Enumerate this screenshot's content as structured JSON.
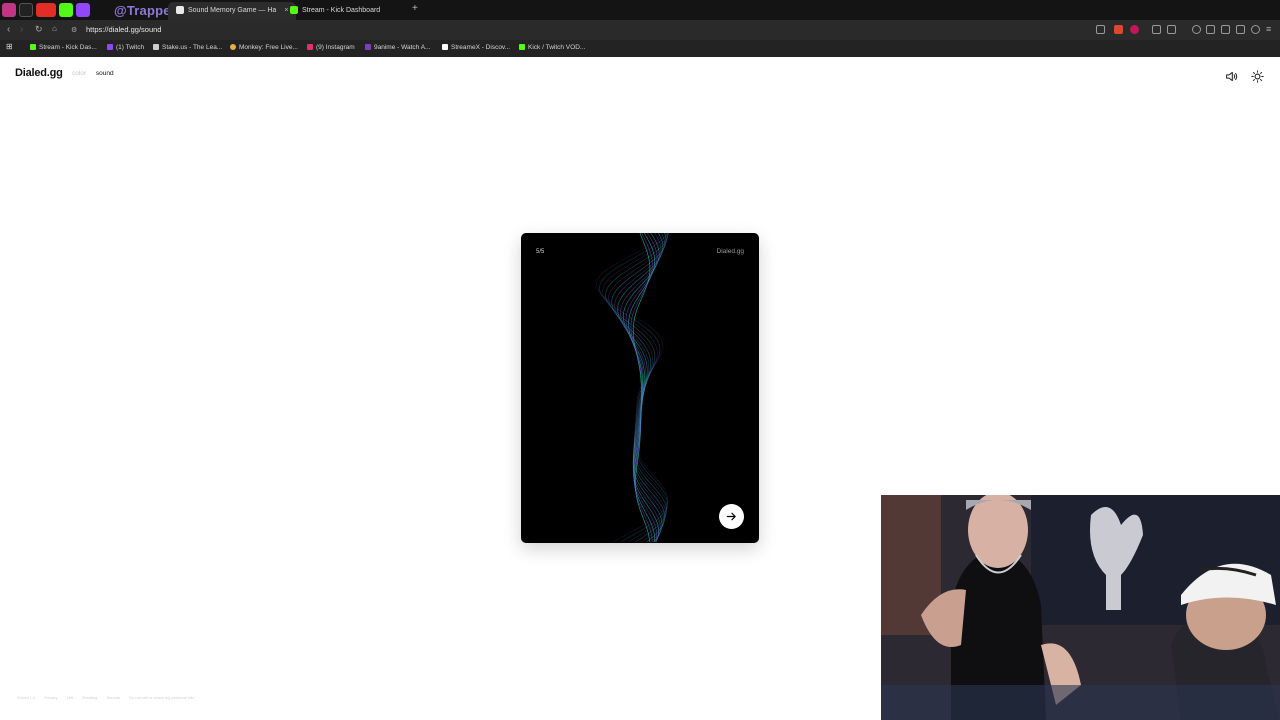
{
  "browser": {
    "overlay": {
      "streamer_name": "@TrappedDots"
    },
    "tabs": [
      {
        "label": "Sound Memory Game — Ha",
        "active": true
      },
      {
        "label": "Stream - Kick Dashboard",
        "active": false
      }
    ],
    "new_tab": "+",
    "tab_close": "×",
    "url": "https://dialed.gg/sound",
    "bookmarks": [
      {
        "label": "Stream - Kick Das...",
        "color": "#53fc18"
      },
      {
        "label": "(1) Twitch",
        "color": "#9146ff"
      },
      {
        "label": "Stake.us - The Lea...",
        "color": "#cccccc"
      },
      {
        "label": "Monkey: Free Live...",
        "color": "#e8b040"
      },
      {
        "label": "(9) Instagram",
        "color": "#e1306c"
      },
      {
        "label": "9anime - Watch A...",
        "color": "#7b3fbf"
      },
      {
        "label": "StreameX - Discov...",
        "color": "#ffffff"
      },
      {
        "label": "Kick / Twitch VOD...",
        "color": "#53fc18"
      }
    ]
  },
  "site": {
    "brand": "Dialed.gg",
    "nav": {
      "color": "color",
      "sound": "sound"
    },
    "icons": {
      "volume": "volume-icon",
      "theme": "sun-icon"
    }
  },
  "card": {
    "counter": "5/5",
    "brand": "Dialed.gg",
    "next_icon": "arrow-right-icon"
  },
  "footer": {
    "items": [
      "Sound 1.0",
      "Privacy",
      "Left",
      "Rotating",
      "Sounds",
      "Do not sell or share my personal info"
    ]
  },
  "colors": {
    "wave_primary": "#1fd1a8",
    "wave_secondary": "#7a3bd6",
    "card_bg": "#000000"
  }
}
